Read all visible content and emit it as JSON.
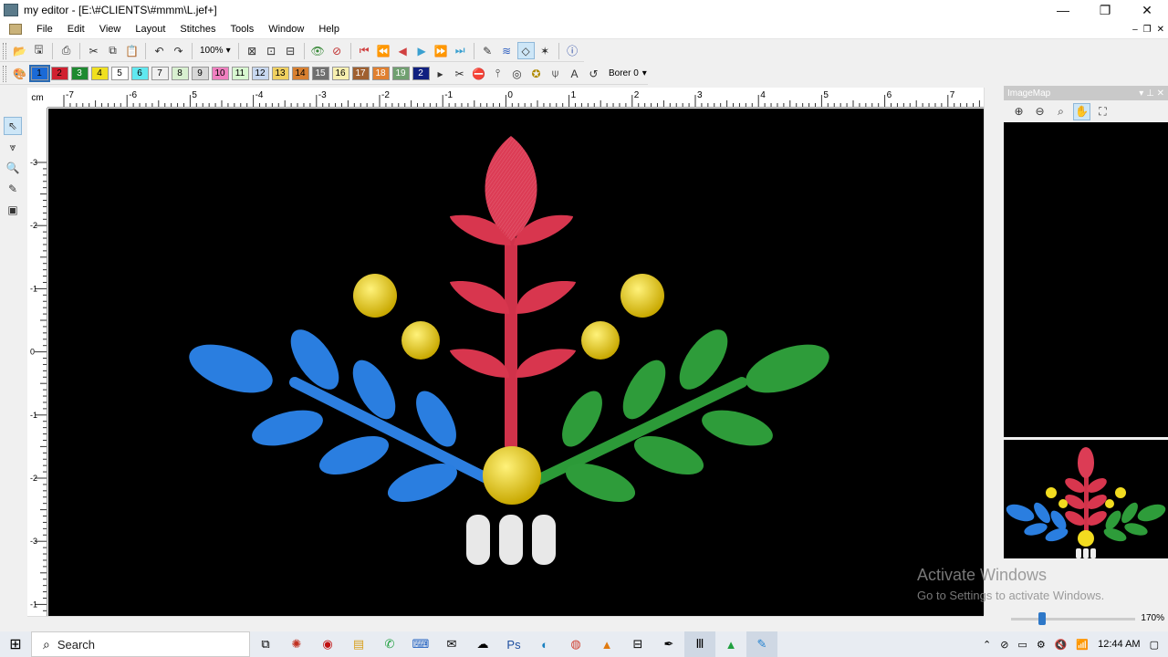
{
  "window": {
    "title": "my editor - [E:\\#CLIENTS\\#mmm\\L.jef+]",
    "minimize": "—",
    "restore": "❐",
    "close": "✕"
  },
  "menu": {
    "items": [
      "File",
      "Edit",
      "View",
      "Layout",
      "Stitches",
      "Tools",
      "Window",
      "Help"
    ],
    "mdi": [
      "–",
      "❐",
      "✕"
    ]
  },
  "toolbar1": {
    "zoom_value": "100%"
  },
  "toolbar2": {
    "colors": [
      {
        "n": "1",
        "c": "#1b6ad6",
        "t": "#000"
      },
      {
        "n": "2",
        "c": "#d02030",
        "t": "#000"
      },
      {
        "n": "3",
        "c": "#1e8a30",
        "t": "#fff"
      },
      {
        "n": "4",
        "c": "#f0e020",
        "t": "#000"
      },
      {
        "n": "5",
        "c": "#ffffff",
        "t": "#000"
      },
      {
        "n": "6",
        "c": "#60e8f0",
        "t": "#000"
      },
      {
        "n": "7",
        "c": "#f0f0f0",
        "t": "#000"
      },
      {
        "n": "8",
        "c": "#d8f0d0",
        "t": "#000"
      },
      {
        "n": "9",
        "c": "#d8d8d8",
        "t": "#000"
      },
      {
        "n": "10",
        "c": "#f080c0",
        "t": "#000"
      },
      {
        "n": "11",
        "c": "#d8f8d0",
        "t": "#000"
      },
      {
        "n": "12",
        "c": "#c8d8f0",
        "t": "#000"
      },
      {
        "n": "13",
        "c": "#f0d060",
        "t": "#000"
      },
      {
        "n": "14",
        "c": "#d88030",
        "t": "#000"
      },
      {
        "n": "15",
        "c": "#707070",
        "t": "#fff"
      },
      {
        "n": "16",
        "c": "#f8f0b0",
        "t": "#000"
      },
      {
        "n": "17",
        "c": "#a06030",
        "t": "#fff"
      },
      {
        "n": "18",
        "c": "#e08030",
        "t": "#fff"
      },
      {
        "n": "19",
        "c": "#70a070",
        "t": "#fff"
      },
      {
        "n": "2",
        "c": "#102080",
        "t": "#fff"
      }
    ],
    "borer_label": "Borer 0"
  },
  "rulers": {
    "unit": "cm",
    "h_ticks": [
      "-7",
      "-6",
      "5",
      "-4",
      "-3",
      "-2",
      "-1",
      "0",
      "1",
      "2",
      "3",
      "4",
      "5",
      "6",
      "7"
    ],
    "v_ticks": [
      "-3",
      "-2",
      "-1",
      "0",
      "-1",
      "-2",
      "-3",
      "-1"
    ]
  },
  "panel": {
    "title": "ImageMap"
  },
  "watermark": {
    "line1": "Activate Windows",
    "line2": "Go to Settings to activate Windows."
  },
  "zoom": {
    "percent": "170%",
    "slider_fraction": 0.25
  },
  "taskbar": {
    "search_label": "Search",
    "time": "12:44 AM"
  }
}
